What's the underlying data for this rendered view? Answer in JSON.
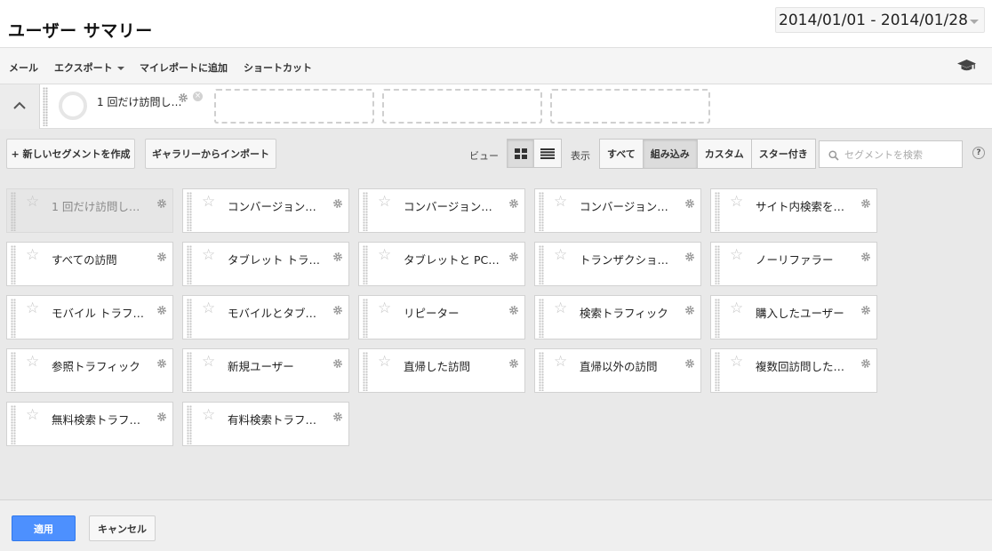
{
  "header": {
    "title": "ユーザー サマリー",
    "date_range": "2014/01/01 - 2014/01/28"
  },
  "toolbar": {
    "mail": "メール",
    "export": "エクスポート",
    "add_to_report": "マイレポートに追加",
    "shortcut": "ショートカット",
    "icon": "graduation-cap-icon"
  },
  "active_segments": {
    "first": "1 回だけ訪問し…"
  },
  "controls": {
    "new_segment": "+ 新しいセグメントを作成",
    "import_gallery": "ギャラリーからインポート",
    "view_label": "ビュー",
    "display_label": "表示",
    "filters": [
      "すべて",
      "組み込み",
      "カスタム",
      "スター付き"
    ],
    "active_filter": "組み込み",
    "search_placeholder": "セグメントを検索",
    "help": "?"
  },
  "segments": [
    {
      "name": "1 回だけ訪問し…",
      "selected": true
    },
    {
      "name": "コンバージョン…"
    },
    {
      "name": "コンバージョン…"
    },
    {
      "name": "コンバージョン…"
    },
    {
      "name": "サイト内検索を…"
    },
    {
      "name": "すべての訪問"
    },
    {
      "name": "タブレット トラ…"
    },
    {
      "name": "タブレットと PC…"
    },
    {
      "name": "トランザクショ…"
    },
    {
      "name": "ノーリファラー"
    },
    {
      "name": "モバイル トラフ…"
    },
    {
      "name": "モバイルとタブ…"
    },
    {
      "name": "リピーター"
    },
    {
      "name": "検索トラフィック"
    },
    {
      "name": "購入したユーザー"
    },
    {
      "name": "参照トラフィック"
    },
    {
      "name": "新規ユーザー"
    },
    {
      "name": "直帰した訪問"
    },
    {
      "name": "直帰以外の訪問"
    },
    {
      "name": "複数回訪問した…"
    },
    {
      "name": "無料検索トラフ…"
    },
    {
      "name": "有料検索トラフ…"
    }
  ],
  "footer": {
    "apply": "適用",
    "cancel": "キャンセル"
  },
  "colors": {
    "accent": "#4d90fe"
  }
}
